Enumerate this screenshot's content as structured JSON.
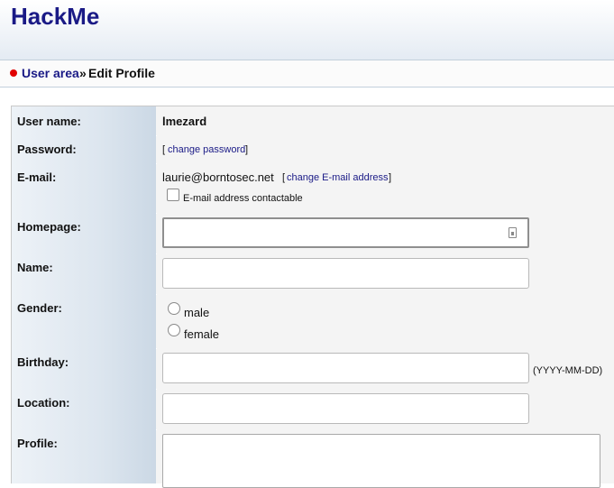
{
  "site": {
    "title": "HackMe"
  },
  "breadcrumb": {
    "link": "User area",
    "separator": "»",
    "current": "Edit Profile"
  },
  "form": {
    "username": {
      "label": "User name:",
      "value": "lmezard"
    },
    "password": {
      "label": "Password:",
      "link": "change password"
    },
    "email": {
      "label": "E-mail:",
      "value": "laurie@borntosec.net",
      "link": "change E-mail address",
      "contactable_label": "E-mail address contactable",
      "contactable_checked": false
    },
    "homepage": {
      "label": "Homepage:",
      "value": ""
    },
    "name": {
      "label": "Name:",
      "value": ""
    },
    "gender": {
      "label": "Gender:",
      "options": [
        "male",
        "female"
      ],
      "selected": null
    },
    "birthday": {
      "label": "Birthday:",
      "value": "",
      "hint": "(YYYY-MM-DD)"
    },
    "location": {
      "label": "Location:",
      "value": ""
    },
    "profile": {
      "label": "Profile:",
      "value": ""
    }
  },
  "colors": {
    "title": "#1a1a86",
    "link": "#1a1a86",
    "bullet": "#e00000"
  }
}
